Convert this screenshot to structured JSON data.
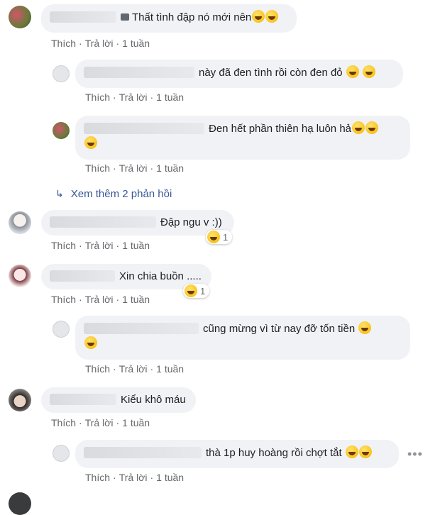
{
  "actions": {
    "like": "Thích",
    "reply": "Trả lời",
    "time": "1 tuần",
    "sep": "·"
  },
  "comments": [
    {
      "text": "Thất tình đập nó mới nên"
    },
    {
      "text": "này đã đen tình rồi còn đen đỏ"
    },
    {
      "text": "Đen hết phần thiên hạ luôn hả"
    },
    {
      "text": "Đập ngu v :))",
      "reaction_count": "1"
    },
    {
      "text": "Xin chia buồn .....",
      "reaction_count": "1"
    },
    {
      "text": "cũng mừng vì từ nay đỡ tốn tiền"
    },
    {
      "text": "Kiểu khô máu"
    },
    {
      "text": "thà 1p huy hoàng rồi chợt tắt"
    }
  ],
  "more_replies": "Xem thêm 2 phản hồi",
  "options_icon": "more-horizontal-icon"
}
